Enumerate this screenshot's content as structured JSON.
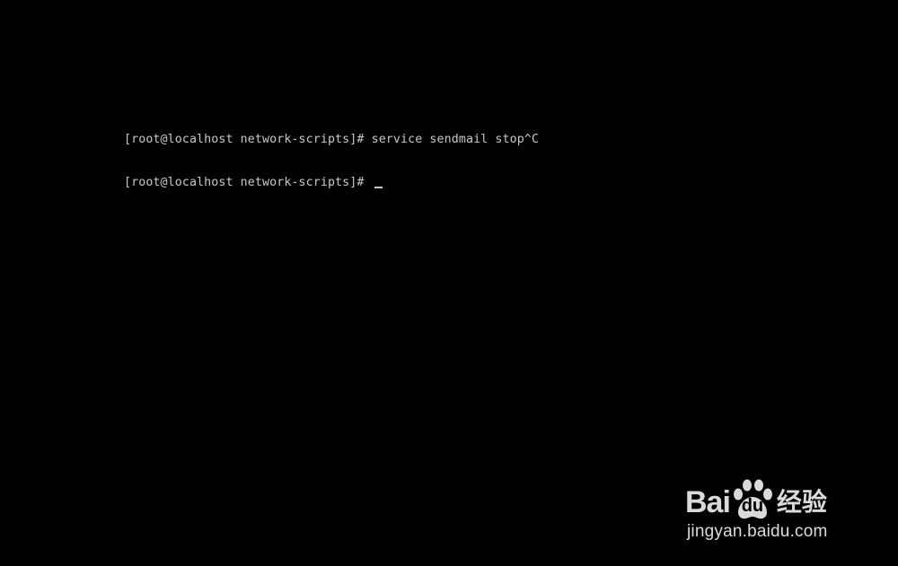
{
  "terminal": {
    "lines": [
      {
        "prompt": "[root@localhost network-scripts]#",
        "command": " service sendmail stop^C"
      },
      {
        "prompt": "[root@localhost network-scripts]#",
        "command": " "
      }
    ],
    "text_color": "#c8c8c8",
    "background_color": "#000000"
  },
  "watermark": {
    "brand_latin": "Bai",
    "brand_paw_text": "du",
    "brand_cn": "经验",
    "url": "jingyan.baidu.com",
    "icon": "paw-icon"
  }
}
